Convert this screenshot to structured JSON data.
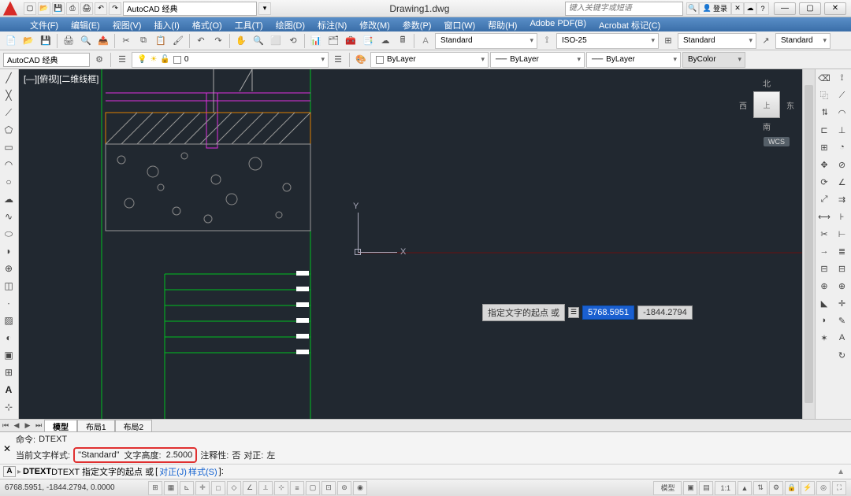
{
  "title": "Drawing1.dwg",
  "search_placeholder": "键入关键字或短语",
  "login_label": "登录",
  "workspace_qat": "AutoCAD 经典",
  "menus": [
    "文件(F)",
    "编辑(E)",
    "视图(V)",
    "插入(I)",
    "格式(O)",
    "工具(T)",
    "绘图(D)",
    "标注(N)",
    "修改(M)",
    "参数(P)",
    "窗口(W)",
    "帮助(H)",
    "Adobe PDF(B)",
    "Acrobat 标记(C)"
  ],
  "styles_row": {
    "text_style": "Standard",
    "dim_style": "ISO-25",
    "table_style": "Standard",
    "mleader_style": "Standard"
  },
  "layers_row": {
    "workspace_combo": "AutoCAD 经典",
    "layer_combo": "ByLayer",
    "color_combo": "ByLayer",
    "ltype_combo": "ByLayer",
    "lweight_combo": "ByColor"
  },
  "viewport_label": "[—][俯视][二维线框]",
  "viewcube": {
    "n": "北",
    "s": "南",
    "e": "东",
    "w": "西",
    "face": "上"
  },
  "wcs": "WCS",
  "axis": {
    "x": "X",
    "y": "Y"
  },
  "dynamic_input": {
    "prompt": "指定文字的起点 或",
    "x": "5768.5951",
    "y": "-1844.2794"
  },
  "tabs": {
    "model": "模型",
    "layout1": "布局1",
    "layout2": "布局2"
  },
  "command": {
    "line1_prefix": "命令:",
    "line1_cmd": "DTEXT",
    "line2_prefix": "当前文字样式:",
    "style_quoted": "\"Standard\"",
    "height_label": "文字高度:",
    "height_value": "2.5000",
    "annot_label": "注释性:",
    "annot_value": "否",
    "justify_label": "对正:",
    "justify_value": "左",
    "input_prefix": "DTEXT 指定文字的起点 或",
    "opt_j": "对正(J)",
    "opt_s": "样式(S)",
    "opt_sep": "[",
    "opt_close": "]:"
  },
  "status": {
    "coords": "6768.5951,  -1844.2794,  0.0000",
    "model_btn": "模型",
    "scale": "1:1"
  }
}
